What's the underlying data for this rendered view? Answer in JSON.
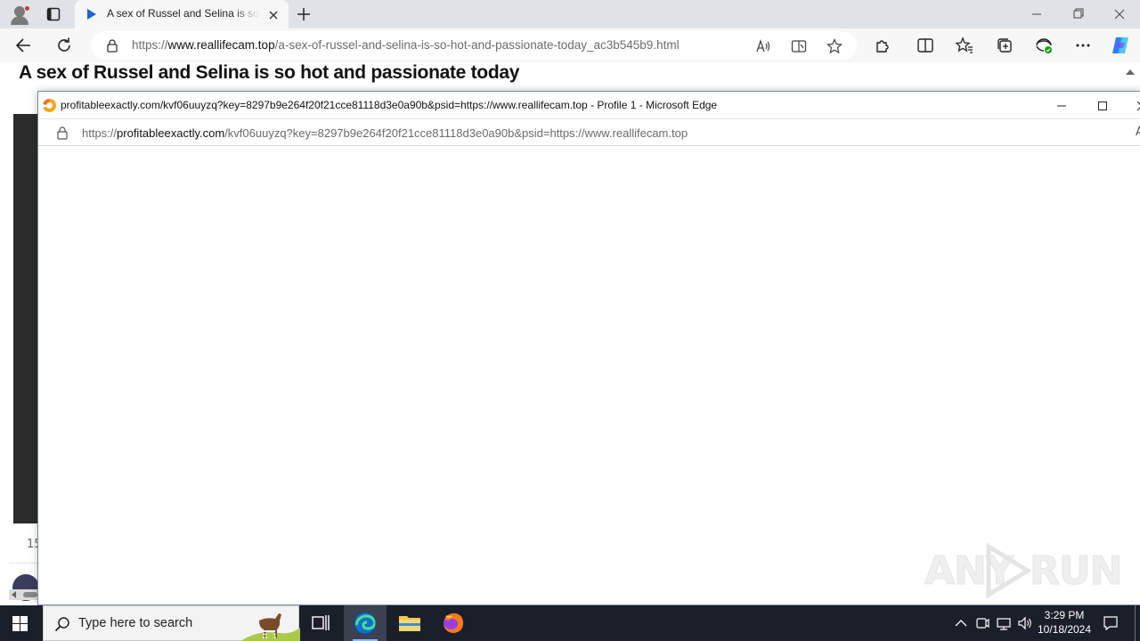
{
  "browser": {
    "tab": {
      "title": "A sex of Russel and Selina is so hot and passionate today"
    },
    "address": {
      "scheme": "https://",
      "domain": "www.reallifecam.top",
      "path": "/a-sex-of-russel-and-selina-is-so-hot-and-passionate-today_ac3b545b9.html"
    }
  },
  "page": {
    "title": "A sex of Russel and Selina is so hot and passionate today",
    "count_fragment": "15"
  },
  "popup": {
    "window_title": "profitableexactly.com/kvf06uuyzq?key=8297b9e264f20f21cce81118d3e0a90b&psid=https://www.reallifecam.top - Profile 1 - Microsoft Edge",
    "address": {
      "scheme": "https://",
      "domain": "profitableexactly.com",
      "path": "/kvf06uuyzq?key=8297b9e264f20f21cce81118d3e0a90b&psid=https://www.reallifecam.top"
    },
    "read_aloud_fragment": "A"
  },
  "watermark": {
    "text_left": "ANY",
    "text_right": "RUN"
  },
  "taskbar": {
    "search_placeholder": "Type here to search",
    "time": "3:29 PM",
    "date": "10/18/2024"
  },
  "colors": {
    "accent": "#1d62d6",
    "taskbar": "#1b1f2a",
    "tab_strip": "#dfe3e7"
  }
}
